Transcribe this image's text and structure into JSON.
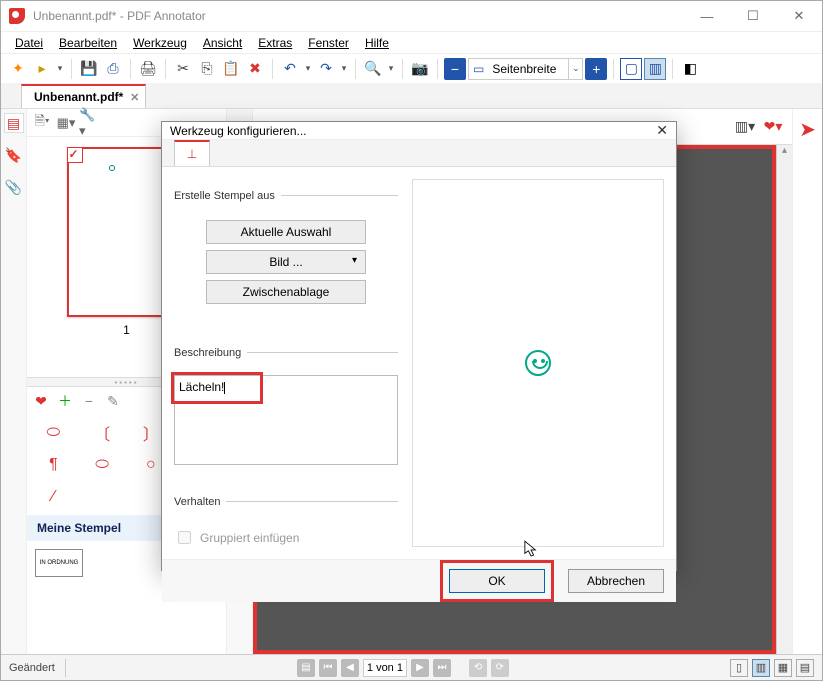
{
  "window": {
    "title": "Unbenannt.pdf* - PDF Annotator",
    "controls": {
      "min": "—",
      "max": "☐",
      "close": "✕"
    }
  },
  "menubar": [
    "Datei",
    "Bearbeiten",
    "Werkzeug",
    "Ansicht",
    "Extras",
    "Fenster",
    "Hilfe"
  ],
  "toolbar": {
    "zoom_value": "Seitenbreite"
  },
  "tabs": {
    "doc": "Unbenannt.pdf*"
  },
  "thumbs": {
    "page_num": "1"
  },
  "stamps": {
    "header": "Meine Stempel",
    "sample": "IN ORDNUNG"
  },
  "status": {
    "label": "Geändert",
    "page_field": "1 von 1"
  },
  "dialog": {
    "title": "Werkzeug konfigurieren...",
    "group1": "Erstelle Stempel aus",
    "btn_selection": "Aktuelle Auswahl",
    "btn_image": "Bild ...",
    "btn_clipboard": "Zwischenablage",
    "group2": "Beschreibung",
    "desc_value": "Lächeln!",
    "group3": "Verhalten",
    "check_group": "Gruppiert einfügen",
    "ok": "OK",
    "cancel": "Abbrechen"
  }
}
